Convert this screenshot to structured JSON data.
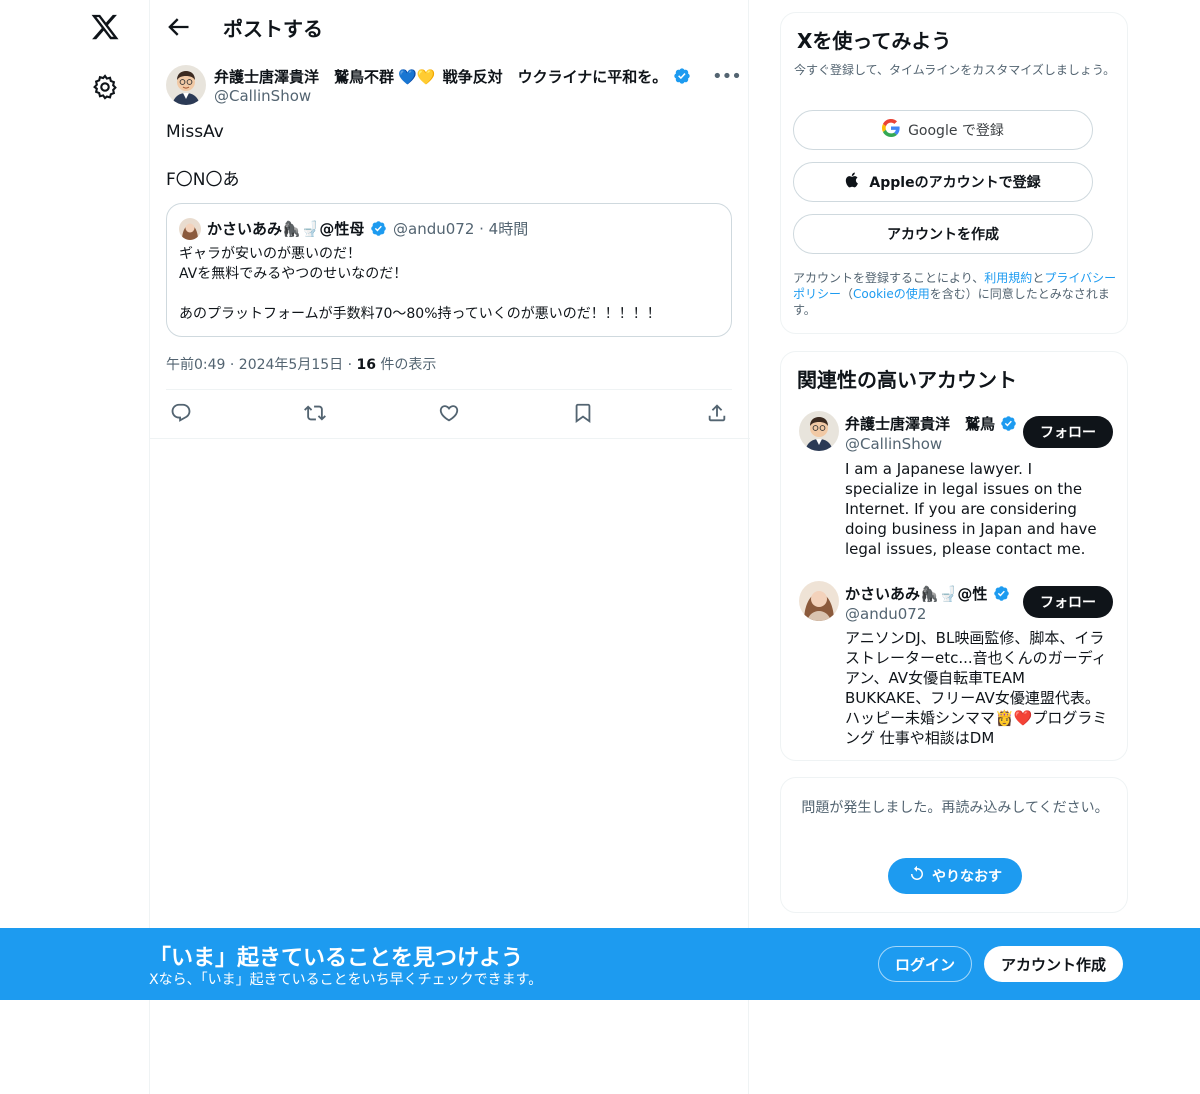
{
  "nav": {
    "logo_icon": "x-logo-icon",
    "settings_icon": "gear-icon"
  },
  "header": {
    "title": "ポストする",
    "back_icon": "arrow-left-icon"
  },
  "post": {
    "author_name": "弁護士唐澤貴洋　鷲鳥不群",
    "author_hearts": "💙💛",
    "author_name_suffix": "戦争反対　ウクライナに平和を。",
    "author_handle": "@CallinShow",
    "text": "MissAv\n\nF〇N〇あ",
    "quote": {
      "name": "かさいあみ🦍🚽@性母",
      "handle_time": "@andu072 · 4時間",
      "text": "ギャラが安いのが悪いのだ！\nAVを無料でみるやつのせいなのだ！\n\nあのプラットフォームが手数料70〜80%持っていくのが悪いのだ！！！！！"
    },
    "timestamp": "午前0:49 · 2024年5月15日 · ",
    "views_count": "16",
    "views_label": " 件の表示"
  },
  "signup": {
    "title": "Xを使ってみよう",
    "subtitle": "今すぐ登録して、タイムラインをカスタマイズしましょう。",
    "google_label": "Google で登録",
    "apple_label": "Appleのアカウントで登録",
    "create_label": "アカウントを作成",
    "terms_prefix": "アカウントを登録することにより、",
    "terms_link": "利用規約",
    "terms_mid": "と",
    "privacy_link": "プライバシーポリシー",
    "terms_paren_open": "（",
    "cookie_link": "Cookieの使用",
    "terms_suffix": "を含む）に同意したとみなされます。"
  },
  "related": {
    "title": "関連性の高いアカウント",
    "accounts": [
      {
        "name": "弁護士唐澤貴洋　鷲鳥",
        "handle": "@CallinShow",
        "bio": "I am a Japanese lawyer. I specialize in legal issues on the Internet. If you are considering doing business in Japan and have legal issues, please contact me.",
        "follow_label": "フォロー"
      },
      {
        "name": "かさいあみ🦍🚽@性",
        "handle": "@andu072",
        "bio": "アニソンDJ、BL映画監修、脚本、イラストレーターetc...音也くんのガーディアン、AV女優自転車TEAM BUKKAKE、フリーAV女優連盟代表。ハッピー未婚シンママ👸❤️プログラミング 仕事や相談はDM",
        "follow_label": "フォロー"
      }
    ]
  },
  "error_card": {
    "message": "問題が発生しました。再読み込みしてください。",
    "retry_label": "やりなおす"
  },
  "banner": {
    "title": "「いま」起きていることを見つけよう",
    "subtitle": "Xなら、「いま」起きていることをいち早くチェックできます。",
    "login_label": "ログイン",
    "signup_label": "アカウント作成"
  },
  "colors": {
    "accent": "#1d9bf0",
    "text": "#0f1419",
    "secondary": "#536471",
    "border": "#eff3f4"
  }
}
